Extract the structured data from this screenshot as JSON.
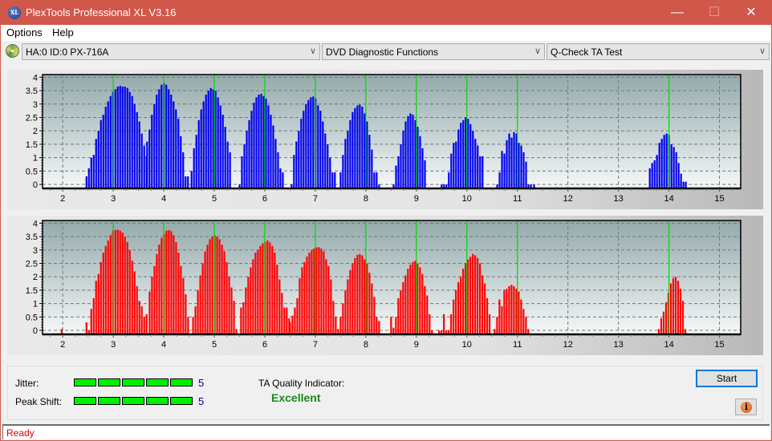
{
  "window": {
    "title": "PlexTools Professional XL V3.16",
    "app_icon_text": "XL",
    "minimize_glyph": "—",
    "maximize_glyph": "☐",
    "close_glyph": "✕"
  },
  "menu": {
    "items": [
      "Options",
      "Help"
    ]
  },
  "toolbar": {
    "drive_selected": "HA:0 ID:0  PX-716A",
    "function_selected": "DVD Diagnostic Functions",
    "test_selected": "Q-Check TA Test",
    "dropdown_glyph": "∨"
  },
  "colors": {
    "titlebar": "#d0574a",
    "lands_bars": "#0000ee",
    "pits_bars": "#ff0000",
    "reference_lines": "#00dd00",
    "quality_good": "#1a8a1a",
    "status_text": "#e00000"
  },
  "chart_data": [
    {
      "type": "bar",
      "name": "upper-ta-histogram",
      "series_color": "#0000ee",
      "xlim": [
        1.6,
        15.42
      ],
      "ylim": [
        -0.15,
        4.1
      ],
      "x_ticks": [
        2,
        3,
        4,
        5,
        6,
        7,
        8,
        9,
        10,
        11,
        12,
        13,
        14,
        15
      ],
      "y_ticks": [
        0,
        0.5,
        1,
        1.5,
        2,
        2.5,
        3,
        3.5,
        4
      ],
      "y_tick_labels": [
        "0",
        "0.5",
        "1",
        "1.5",
        "2",
        "2.5",
        "3",
        "3.5",
        "4"
      ],
      "grid": true,
      "reference_lines_x": [
        3,
        4,
        5,
        6,
        7,
        8,
        9,
        10,
        11,
        14
      ],
      "bar_step": 0.0476,
      "clusters": [
        {
          "start": 2.47,
          "values": [
            0.3,
            0.6,
            1.0,
            1.1,
            1.7,
            2.0,
            2.4,
            2.6,
            2.9,
            3.1,
            3.3,
            3.45,
            3.55,
            3.65,
            3.68,
            3.65,
            3.65,
            3.6,
            3.45,
            3.3,
            3.0,
            2.7,
            2.35,
            1.9,
            1.45,
            1.05
          ]
        },
        {
          "start": 3.67,
          "values": [
            1.6,
            2.05,
            2.6,
            3.0,
            3.35,
            3.55,
            3.72,
            3.78,
            3.72,
            3.55,
            3.35,
            3.1,
            2.8,
            2.45,
            1.8,
            1.2,
            0.3,
            0.3
          ]
        },
        {
          "start": 4.55,
          "values": [
            0.5,
            1.35,
            1.85,
            2.4,
            2.8,
            3.1,
            3.35,
            3.5,
            3.6,
            3.55,
            3.5,
            3.25,
            2.95,
            2.6,
            2.15,
            1.6,
            1.2
          ]
        },
        {
          "start": 5.5,
          "values": [
            0.0,
            1.05,
            1.5,
            2.0,
            2.4,
            2.75,
            3.05,
            3.25,
            3.35,
            3.38,
            3.3,
            3.2,
            2.95,
            2.6,
            2.2,
            1.7,
            1.2,
            0.6,
            0.45
          ]
        },
        {
          "start": 6.53,
          "values": [
            0.0,
            1.1,
            1.6,
            2.0,
            2.45,
            2.75,
            3.0,
            3.15,
            3.25,
            3.28,
            3.2,
            2.95,
            2.75,
            2.35,
            1.9,
            1.5,
            1.0,
            0.45,
            0.45
          ]
        },
        {
          "start": 7.5,
          "values": [
            0.45,
            1.1,
            1.7,
            2.0,
            2.4,
            2.7,
            2.85,
            2.95,
            2.98,
            2.9,
            2.65,
            2.35,
            1.85,
            1.3,
            0.45,
            0.45,
            0.0
          ]
        },
        {
          "start": 8.55,
          "values": [
            0.0,
            0.7,
            1.05,
            1.5,
            2.0,
            2.35,
            2.55,
            2.65,
            2.6,
            2.4,
            2.15,
            1.8,
            1.35,
            0.9
          ]
        },
        {
          "start": 9.5,
          "values": [
            0.0,
            0.0,
            0.0,
            0.45,
            1.15,
            1.55,
            1.6,
            2.05,
            2.3,
            2.4,
            2.5,
            2.45,
            2.25,
            2.0,
            1.7,
            1.45,
            1.05,
            1.05
          ]
        },
        {
          "start": 10.6,
          "values": [
            0.0,
            0.45,
            1.25,
            1.15,
            1.65,
            1.9,
            1.75,
            1.95,
            1.9,
            1.55,
            1.45,
            1.2,
            0.85,
            0.0,
            0.0
          ]
        },
        {
          "start": 13.62,
          "values": [
            0.6,
            0.8,
            0.9,
            1.1,
            1.55,
            1.7,
            1.85,
            1.9,
            1.85,
            1.5,
            1.4,
            1.2,
            0.8,
            0.4,
            0.1,
            0.1
          ]
        }
      ],
      "extra_bars": [
        {
          "x": 11.33,
          "y": 0.0
        },
        {
          "x": 8.0,
          "y": 0.0
        }
      ]
    },
    {
      "type": "bar",
      "name": "lower-ta-histogram",
      "series_color": "#ff0000",
      "xlim": [
        1.6,
        15.42
      ],
      "ylim": [
        -0.15,
        4.1
      ],
      "x_ticks": [
        2,
        3,
        4,
        5,
        6,
        7,
        8,
        9,
        10,
        11,
        12,
        13,
        14,
        15
      ],
      "y_ticks": [
        0,
        0.5,
        1,
        1.5,
        2,
        2.5,
        3,
        3.5,
        4
      ],
      "y_tick_labels": [
        "0",
        "0.5",
        "1",
        "1.5",
        "2",
        "2.5",
        "3",
        "3.5",
        "4"
      ],
      "grid": true,
      "reference_lines_x": [
        3,
        4,
        5,
        6,
        7,
        8,
        9,
        10,
        11,
        14
      ],
      "bar_step": 0.0476,
      "clusters": [
        {
          "start": 1.98,
          "values": [
            0.05
          ]
        },
        {
          "start": 2.47,
          "values": [
            0.3,
            0.0,
            0.8,
            1.2,
            1.85,
            2.1,
            2.55,
            2.9,
            3.15,
            3.35,
            3.55,
            3.72,
            3.74,
            3.76,
            3.72,
            3.65,
            3.5,
            3.3,
            3.0,
            2.6,
            2.2,
            1.65,
            1.1,
            0.9,
            0.5,
            0.6
          ]
        },
        {
          "start": 3.72,
          "values": [
            1.45,
            2.0,
            2.4,
            2.85,
            3.2,
            3.45,
            3.6,
            3.72,
            3.74,
            3.7,
            3.55,
            3.3,
            2.9,
            2.4,
            1.95,
            1.35,
            0.5
          ]
        },
        {
          "start": 4.58,
          "values": [
            0.5,
            0.9,
            1.5,
            2.05,
            2.5,
            2.95,
            3.2,
            3.4,
            3.5,
            3.55,
            3.5,
            3.4,
            3.2,
            2.95,
            2.55,
            2.0,
            1.6,
            1.1,
            0.05
          ]
        },
        {
          "start": 5.53,
          "values": [
            0.85,
            1.05,
            1.6,
            2.0,
            2.35,
            2.65,
            2.9,
            3.0,
            3.15,
            3.25,
            3.3,
            3.35,
            3.28,
            3.15,
            2.9,
            2.45,
            1.9,
            1.4,
            0.85,
            0.85,
            0.45
          ]
        },
        {
          "start": 6.5,
          "values": [
            0.3,
            0.55,
            0.85,
            1.2,
            1.95,
            2.35,
            2.55,
            2.75,
            2.9,
            3.0,
            3.05,
            3.1,
            3.1,
            3.05,
            2.95,
            2.65,
            2.4,
            1.9,
            1.1,
            0.5,
            0.05
          ]
        },
        {
          "start": 7.5,
          "values": [
            0.5,
            1.0,
            1.5,
            1.9,
            2.25,
            2.5,
            2.7,
            2.82,
            2.85,
            2.8,
            2.65,
            2.5,
            2.15,
            1.75,
            1.25,
            0.5,
            0.35
          ]
        },
        {
          "start": 8.5,
          "values": [
            0.5,
            0.1,
            0.5,
            1.2,
            1.5,
            1.8,
            2.05,
            2.3,
            2.45,
            2.55,
            2.6,
            2.5,
            2.35,
            2.1,
            1.65,
            1.3,
            0.6,
            0.0
          ]
        },
        {
          "start": 9.45,
          "values": [
            0.0,
            0.0,
            0.6,
            0.0,
            0.0,
            0.6,
            1.15,
            1.5,
            1.8,
            2.0,
            2.3,
            2.5,
            2.65,
            2.75,
            2.85,
            2.8,
            2.7,
            2.5,
            2.05,
            1.75,
            1.2,
            0.6
          ]
        },
        {
          "start": 10.55,
          "values": [
            0.05,
            0.5,
            1.15,
            0.9,
            1.5,
            1.55,
            1.65,
            1.7,
            1.65,
            1.55,
            1.45,
            1.15,
            0.8,
            0.5,
            0.05
          ]
        },
        {
          "start": 13.8,
          "values": [
            0.05,
            0.45,
            0.7,
            1.05,
            1.4,
            1.75,
            1.95,
            2.0,
            1.85,
            1.55,
            1.1,
            0.05
          ]
        }
      ],
      "extra_bars": []
    }
  ],
  "results": {
    "jitter_label": "Jitter:",
    "jitter_value": "5",
    "jitter_level": 5,
    "jitter_max": 5,
    "peak_shift_label": "Peak Shift:",
    "peak_shift_value": "5",
    "peak_shift_level": 5,
    "peak_shift_max": 5,
    "ta_quality_label": "TA Quality Indicator:",
    "ta_quality_value": "Excellent"
  },
  "buttons": {
    "start_label": "Start",
    "info_glyph": "i"
  },
  "status": {
    "text": "Ready"
  }
}
